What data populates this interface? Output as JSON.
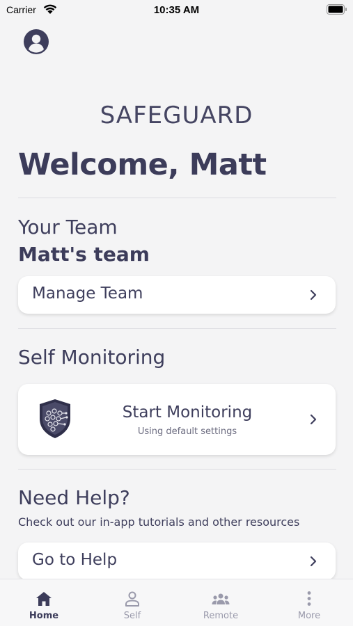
{
  "status_bar": {
    "carrier": "Carrier",
    "time": "10:35 AM"
  },
  "header": {
    "brand": "SAFEGUARD",
    "welcome": "Welcome, Matt"
  },
  "team": {
    "section_title": "Your Team",
    "team_name": "Matt's team",
    "manage_label": "Manage Team"
  },
  "self_monitoring": {
    "section_title": "Self Monitoring",
    "start_label": "Start Monitoring",
    "start_sub": "Using default settings"
  },
  "help": {
    "section_title": "Need Help?",
    "description": "Check out our in-app tutorials and other resources",
    "go_label": "Go to Help"
  },
  "tabs": [
    {
      "label": "Home",
      "icon": "home-icon",
      "active": true
    },
    {
      "label": "Self",
      "icon": "person-icon",
      "active": false
    },
    {
      "label": "Remote",
      "icon": "group-icon",
      "active": false
    },
    {
      "label": "More",
      "icon": "more-vertical-icon",
      "active": false
    }
  ],
  "colors": {
    "text": "#3e3e5c",
    "background": "#f4f4f5",
    "card": "#ffffff",
    "tab_inactive": "#9a9aab"
  }
}
